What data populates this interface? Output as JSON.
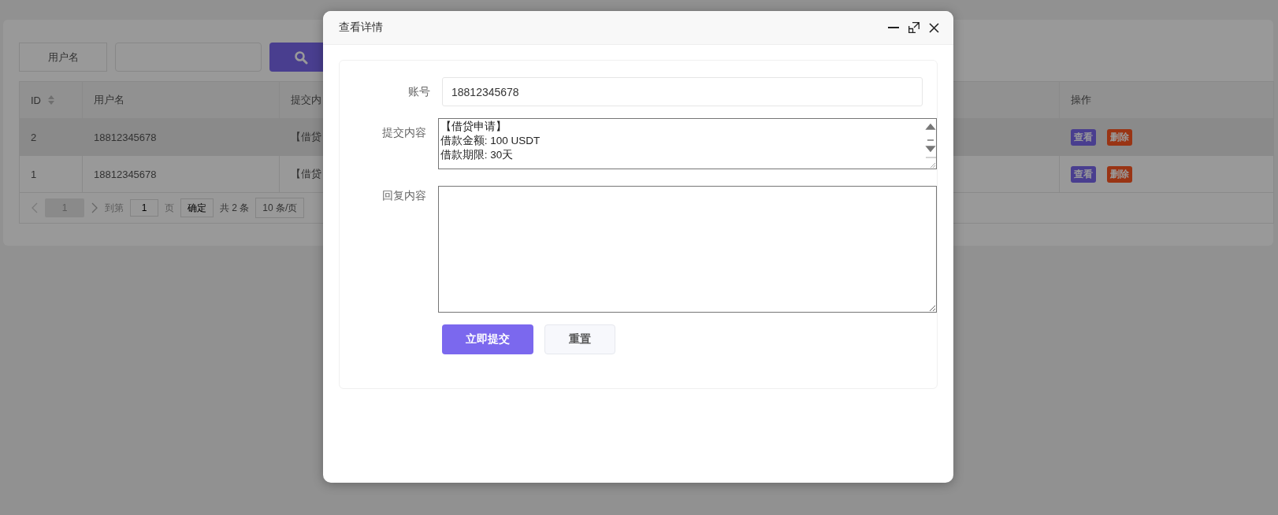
{
  "search": {
    "label": "用户名"
  },
  "table": {
    "columns": [
      {
        "label": "ID",
        "sortable": true
      },
      {
        "label": "用户名"
      },
      {
        "label": "提交内"
      },
      {
        "label": "操作"
      }
    ],
    "rows": [
      {
        "id": "2",
        "username": "18812345678",
        "content": "【借贷",
        "highlighted": true,
        "actions": [
          {
            "label": "查看",
            "kind": "view"
          },
          {
            "label": "删除",
            "kind": "delete"
          }
        ]
      },
      {
        "id": "1",
        "username": "18812345678",
        "content": "【借贷",
        "highlighted": false,
        "actions": [
          {
            "label": "查看",
            "kind": "view"
          },
          {
            "label": "删除",
            "kind": "delete"
          }
        ]
      }
    ]
  },
  "pagination": {
    "page": "1",
    "goto_label": "到第",
    "goto_value": "1",
    "page_unit": "页",
    "confirm": "确定",
    "total": "共 2 条",
    "page_size": "10 条/页"
  },
  "dialog": {
    "title": "查看详情",
    "fields": [
      {
        "kind": "input",
        "label": "账号",
        "value": "18812345678"
      },
      {
        "kind": "scroll_text",
        "label": "提交内容",
        "lines": [
          "【借贷申请】",
          "借款金额: 100 USDT",
          "借款期限: 30天"
        ]
      },
      {
        "kind": "textarea",
        "label": "回复内容"
      }
    ],
    "buttons": [
      {
        "label": "立即提交",
        "kind": "primary"
      },
      {
        "label": "重置",
        "kind": "secondary"
      }
    ]
  }
}
